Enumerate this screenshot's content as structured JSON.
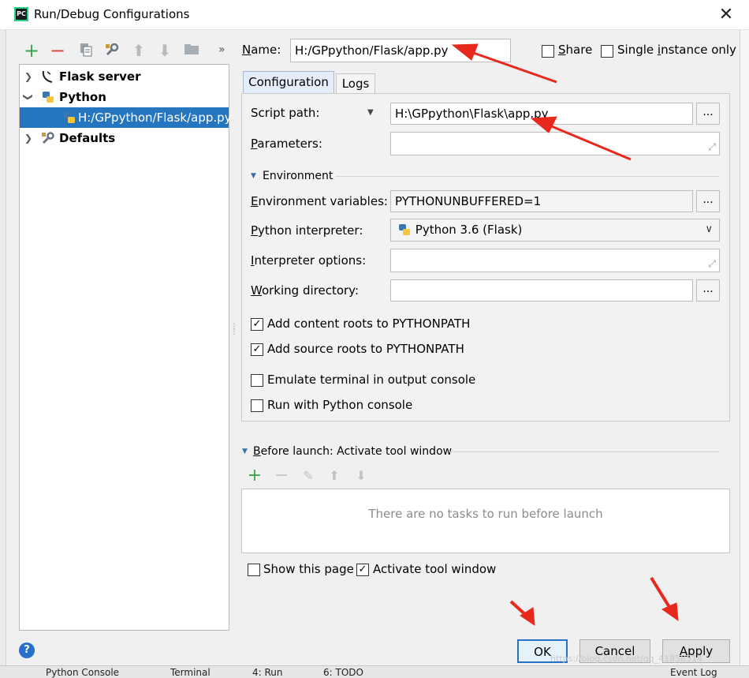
{
  "window": {
    "title": "Run/Debug Configurations",
    "app_icon": "PC"
  },
  "toolbar": {
    "icons": [
      "plus-icon",
      "minus-icon",
      "copy-icon",
      "wrench-icon",
      "arrow-up-icon",
      "arrow-down-icon",
      "folder-icon"
    ],
    "more": "»"
  },
  "tree": {
    "items": [
      {
        "label": "Flask server",
        "icon": "flask-icon"
      },
      {
        "label": "Python",
        "icon": "python-icon"
      },
      {
        "label": "H:/GPpython/Flask/app.py",
        "icon": "python-icon"
      },
      {
        "label": "Defaults",
        "icon": "wrench-icon"
      }
    ]
  },
  "name_field": {
    "label_u": "N",
    "label_rest": "ame:",
    "value": "H:/GPpython/Flask/app.py"
  },
  "share": {
    "label_u": "S",
    "label_rest": "hare",
    "checked": false
  },
  "single_instance": {
    "label_pre": "Single ",
    "label_u": "i",
    "label_rest": "nstance only",
    "checked": false
  },
  "tabs": [
    {
      "label": "Configuration",
      "active": true
    },
    {
      "label": "Logs",
      "active": false
    }
  ],
  "config": {
    "script_path_label": "Script path:",
    "script_path_value": "H:\\GPpython\\Flask\\app.py",
    "parameters_label_u": "P",
    "parameters_label_rest": "arameters:",
    "parameters_value": "",
    "environment_section": "Environment",
    "env_vars_label_u": "E",
    "env_vars_label_rest": "nvironment variables:",
    "env_vars_value": "PYTHONUNBUFFERED=1",
    "interpreter_label_u": "P",
    "interpreter_label_rest": "ython interpreter:",
    "interpreter_value": "Python 3.6 (Flask)",
    "interp_options_label_u": "I",
    "interp_options_label_rest": "nterpreter options:",
    "interp_options_value": "",
    "working_dir_label_u": "W",
    "working_dir_label_rest": "orking directory:",
    "working_dir_value": "",
    "dots": "...",
    "checkboxes": [
      {
        "label": "Add content roots to PYTHONPATH",
        "checked": true
      },
      {
        "label": "Add source roots to PYTHONPATH",
        "checked": true
      },
      {
        "label": "Emulate terminal in output console",
        "checked": false
      },
      {
        "label": "Run with Python console",
        "checked": false
      }
    ]
  },
  "before_launch": {
    "title_u": "B",
    "title_rest": "efore launch: Activate tool window",
    "empty_text": "There are no tasks to run before launch"
  },
  "footer": {
    "show_this_page": {
      "label": "Show this page",
      "checked": false
    },
    "activate_tool_window": {
      "label": "Activate tool window",
      "checked": true
    },
    "ok": "OK",
    "cancel": "Cancel",
    "apply_u": "A",
    "apply_rest": "pply",
    "help": "?"
  },
  "taskbar": {
    "items": [
      "Python Console",
      "Terminal",
      "4: Run",
      "6: TODO",
      "Event Log"
    ],
    "watermark": "https://blog.csdn.net/qq_41858514"
  },
  "colors": {
    "selection": "#2675bf",
    "accent_red": "#e8281c",
    "plus_green": "#3aa64a",
    "minus_red": "#d94a3d"
  }
}
